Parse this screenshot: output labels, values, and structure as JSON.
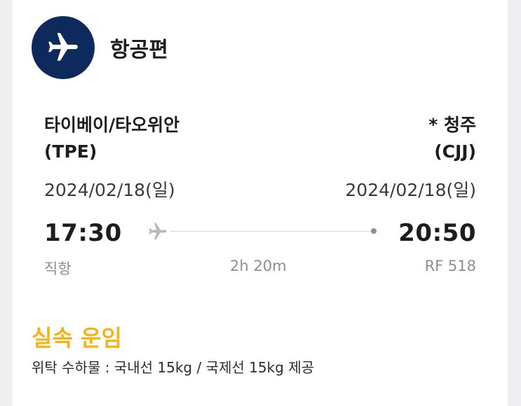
{
  "header": {
    "title": "항공편",
    "icon": "airplane-icon",
    "badge_color": "#0e2a5c"
  },
  "departure": {
    "city": "타이베이/타오위안",
    "code": "(TPE)",
    "date": "2024/02/18(일)",
    "time": "17:30"
  },
  "arrival": {
    "city": "* 청주",
    "code": "(CJJ)",
    "date": "2024/02/18(일)",
    "time": "20:50"
  },
  "flight": {
    "stops": "직항",
    "duration": "2h 20m",
    "number": "RF 518"
  },
  "fare": {
    "title": "실속 운임",
    "title_color": "#f4b316",
    "baggage": "위탁 수하물 : 국내선 15kg / 국제선 15kg 제공"
  }
}
